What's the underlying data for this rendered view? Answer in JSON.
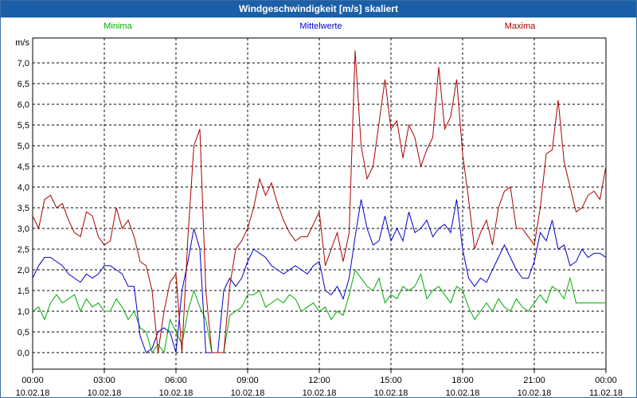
{
  "window": {
    "title": "Windgeschwindigkeit [m/s] skaliert"
  },
  "chart_data": {
    "type": "line",
    "title": "Windgeschwindigkeit [m/s] skaliert",
    "ylabel": "m/s",
    "ylim": [
      -0.4,
      7.6
    ],
    "xlim": [
      0,
      24
    ],
    "grid": true,
    "legend_placement": "top",
    "y_ticks": [
      "0,0",
      "0,5",
      "1,0",
      "1,5",
      "2,0",
      "2,5",
      "3,0",
      "3,5",
      "4,0",
      "4,5",
      "5,0",
      "5,5",
      "6,0",
      "6,5",
      "7,0"
    ],
    "x_ticks": [
      {
        "time": "00:00",
        "date": "10.02.18"
      },
      {
        "time": "03:00",
        "date": "10.02.18"
      },
      {
        "time": "06:00",
        "date": "10.02.18"
      },
      {
        "time": "09:00",
        "date": "10.02.18"
      },
      {
        "time": "12:00",
        "date": "10.02.18"
      },
      {
        "time": "15:00",
        "date": "10.02.18"
      },
      {
        "time": "18:00",
        "date": "10.02.18"
      },
      {
        "time": "21:00",
        "date": "10.02.18"
      },
      {
        "time": "00:00",
        "date": "11.02.18"
      }
    ],
    "series": [
      {
        "name": "Minima",
        "color": "#00aa00",
        "points": [
          [
            0,
            1.0
          ],
          [
            0.25,
            1.1
          ],
          [
            0.5,
            0.8
          ],
          [
            0.75,
            1.2
          ],
          [
            1,
            1.4
          ],
          [
            1.25,
            1.2
          ],
          [
            1.5,
            1.3
          ],
          [
            1.75,
            1.4
          ],
          [
            2,
            1.0
          ],
          [
            2.25,
            1.3
          ],
          [
            2.5,
            1.1
          ],
          [
            2.75,
            1.2
          ],
          [
            3,
            1.0
          ],
          [
            3.25,
            1.0
          ],
          [
            3.5,
            1.3
          ],
          [
            3.75,
            1.1
          ],
          [
            4,
            0.8
          ],
          [
            4.25,
            1.0
          ],
          [
            4.5,
            0.6
          ],
          [
            4.75,
            0.5
          ],
          [
            5,
            0.0
          ],
          [
            5.25,
            0.2
          ],
          [
            5.5,
            0.0
          ],
          [
            5.75,
            0.8
          ],
          [
            6,
            0.5
          ],
          [
            6.25,
            0.2
          ],
          [
            6.5,
            1.0
          ],
          [
            6.75,
            1.5
          ],
          [
            7,
            1.1
          ],
          [
            7.25,
            0.8
          ],
          [
            7.5,
            0.0
          ],
          [
            7.75,
            0.0
          ],
          [
            8,
            0.0
          ],
          [
            8.25,
            0.9
          ],
          [
            8.5,
            1.0
          ],
          [
            8.75,
            1.1
          ],
          [
            9,
            1.4
          ],
          [
            9.25,
            1.4
          ],
          [
            9.5,
            1.5
          ],
          [
            9.75,
            1.1
          ],
          [
            10,
            1.2
          ],
          [
            10.25,
            1.3
          ],
          [
            10.5,
            1.2
          ],
          [
            10.75,
            1.4
          ],
          [
            11,
            1.3
          ],
          [
            11.25,
            1.0
          ],
          [
            11.5,
            1.1
          ],
          [
            11.75,
            1.2
          ],
          [
            12,
            1.0
          ],
          [
            12.25,
            1.1
          ],
          [
            12.5,
            0.8
          ],
          [
            12.75,
            1.0
          ],
          [
            13,
            0.9
          ],
          [
            13.25,
            1.4
          ],
          [
            13.5,
            2.0
          ],
          [
            13.75,
            1.8
          ],
          [
            14,
            1.6
          ],
          [
            14.25,
            1.5
          ],
          [
            14.5,
            1.8
          ],
          [
            14.75,
            1.2
          ],
          [
            15,
            1.4
          ],
          [
            15.25,
            1.3
          ],
          [
            15.5,
            1.6
          ],
          [
            15.75,
            1.5
          ],
          [
            16,
            1.6
          ],
          [
            16.25,
            1.9
          ],
          [
            16.5,
            1.3
          ],
          [
            16.75,
            1.5
          ],
          [
            17,
            1.6
          ],
          [
            17.25,
            1.4
          ],
          [
            17.5,
            1.2
          ],
          [
            17.75,
            1.6
          ],
          [
            18,
            1.5
          ],
          [
            18.25,
            1.1
          ],
          [
            18.5,
            0.8
          ],
          [
            18.75,
            1.0
          ],
          [
            19,
            1.2
          ],
          [
            19.25,
            1.0
          ],
          [
            19.5,
            1.3
          ],
          [
            19.75,
            1.1
          ],
          [
            20,
            1.0
          ],
          [
            20.25,
            1.3
          ],
          [
            20.5,
            1.1
          ],
          [
            20.75,
            1.0
          ],
          [
            21,
            1.2
          ],
          [
            21.25,
            1.4
          ],
          [
            21.5,
            1.2
          ],
          [
            21.75,
            1.6
          ],
          [
            22,
            1.5
          ],
          [
            22.25,
            1.3
          ],
          [
            22.5,
            1.8
          ],
          [
            22.75,
            1.2
          ],
          [
            23,
            1.2
          ],
          [
            23.25,
            1.2
          ],
          [
            23.5,
            1.2
          ],
          [
            23.75,
            1.2
          ],
          [
            24,
            1.2
          ]
        ]
      },
      {
        "name": "Mittelwerte",
        "color": "#0000cc",
        "points": [
          [
            0,
            1.8
          ],
          [
            0.25,
            2.1
          ],
          [
            0.5,
            2.3
          ],
          [
            0.75,
            2.3
          ],
          [
            1,
            2.2
          ],
          [
            1.25,
            2.1
          ],
          [
            1.5,
            1.9
          ],
          [
            1.75,
            1.8
          ],
          [
            2,
            1.7
          ],
          [
            2.25,
            1.9
          ],
          [
            2.5,
            1.8
          ],
          [
            2.75,
            1.9
          ],
          [
            3,
            2.1
          ],
          [
            3.25,
            2.1
          ],
          [
            3.5,
            2.0
          ],
          [
            3.75,
            1.9
          ],
          [
            4,
            1.6
          ],
          [
            4.25,
            1.6
          ],
          [
            4.5,
            0.4
          ],
          [
            4.75,
            0.0
          ],
          [
            5,
            0.1
          ],
          [
            5.25,
            0.5
          ],
          [
            5.5,
            0.6
          ],
          [
            5.75,
            0.5
          ],
          [
            6,
            0.0
          ],
          [
            6.25,
            1.5
          ],
          [
            6.5,
            2.2
          ],
          [
            6.75,
            3.0
          ],
          [
            7,
            2.5
          ],
          [
            7.25,
            0.0
          ],
          [
            7.5,
            0.0
          ],
          [
            7.75,
            0.0
          ],
          [
            8,
            1.5
          ],
          [
            8.25,
            1.8
          ],
          [
            8.5,
            1.6
          ],
          [
            8.75,
            1.8
          ],
          [
            9,
            2.2
          ],
          [
            9.25,
            2.5
          ],
          [
            9.5,
            2.4
          ],
          [
            9.75,
            2.3
          ],
          [
            10,
            2.1
          ],
          [
            10.25,
            2.0
          ],
          [
            10.5,
            1.9
          ],
          [
            10.75,
            2.0
          ],
          [
            11,
            2.1
          ],
          [
            11.25,
            2.0
          ],
          [
            11.5,
            1.9
          ],
          [
            11.75,
            2.1
          ],
          [
            12,
            2.2
          ],
          [
            12.25,
            1.5
          ],
          [
            12.5,
            1.4
          ],
          [
            12.75,
            1.6
          ],
          [
            13,
            1.3
          ],
          [
            13.25,
            1.8
          ],
          [
            13.5,
            2.8
          ],
          [
            13.75,
            3.7
          ],
          [
            14,
            3.0
          ],
          [
            14.25,
            2.6
          ],
          [
            14.5,
            2.7
          ],
          [
            14.75,
            3.3
          ],
          [
            15,
            2.7
          ],
          [
            15.25,
            3.0
          ],
          [
            15.5,
            2.7
          ],
          [
            15.75,
            3.4
          ],
          [
            16,
            2.9
          ],
          [
            16.25,
            3.0
          ],
          [
            16.5,
            3.2
          ],
          [
            16.75,
            2.8
          ],
          [
            17,
            3.0
          ],
          [
            17.25,
            3.1
          ],
          [
            17.5,
            2.9
          ],
          [
            17.75,
            3.7
          ],
          [
            18,
            2.5
          ],
          [
            18.25,
            1.8
          ],
          [
            18.5,
            1.6
          ],
          [
            18.75,
            1.8
          ],
          [
            19,
            1.7
          ],
          [
            19.25,
            2.0
          ],
          [
            19.5,
            2.3
          ],
          [
            19.75,
            2.6
          ],
          [
            20,
            2.3
          ],
          [
            20.25,
            2.0
          ],
          [
            20.5,
            1.8
          ],
          [
            20.75,
            1.8
          ],
          [
            21,
            2.2
          ],
          [
            21.25,
            2.9
          ],
          [
            21.5,
            2.7
          ],
          [
            21.75,
            3.2
          ],
          [
            22,
            2.5
          ],
          [
            22.25,
            2.6
          ],
          [
            22.5,
            2.1
          ],
          [
            22.75,
            2.2
          ],
          [
            23,
            2.5
          ],
          [
            23.25,
            2.3
          ],
          [
            23.5,
            2.4
          ],
          [
            23.75,
            2.4
          ],
          [
            24,
            2.3
          ]
        ]
      },
      {
        "name": "Maxima",
        "color": "#aa0000",
        "points": [
          [
            0,
            3.3
          ],
          [
            0.25,
            3.0
          ],
          [
            0.5,
            3.7
          ],
          [
            0.75,
            3.8
          ],
          [
            1,
            3.5
          ],
          [
            1.25,
            3.6
          ],
          [
            1.5,
            3.2
          ],
          [
            1.75,
            2.9
          ],
          [
            2,
            2.8
          ],
          [
            2.25,
            3.4
          ],
          [
            2.5,
            3.3
          ],
          [
            2.75,
            2.8
          ],
          [
            3,
            2.6
          ],
          [
            3.25,
            2.7
          ],
          [
            3.5,
            3.5
          ],
          [
            3.75,
            3.0
          ],
          [
            4,
            3.2
          ],
          [
            4.25,
            2.8
          ],
          [
            4.5,
            2.2
          ],
          [
            4.75,
            2.1
          ],
          [
            5,
            1.5
          ],
          [
            5.25,
            0.0
          ],
          [
            5.5,
            1.0
          ],
          [
            5.75,
            1.7
          ],
          [
            6,
            1.9
          ],
          [
            6.25,
            0.0
          ],
          [
            6.5,
            2.8
          ],
          [
            6.75,
            5.0
          ],
          [
            7,
            5.4
          ],
          [
            7.25,
            1.5
          ],
          [
            7.5,
            0.0
          ],
          [
            7.75,
            0.0
          ],
          [
            8,
            0.0
          ],
          [
            8.25,
            1.6
          ],
          [
            8.5,
            2.5
          ],
          [
            8.75,
            2.7
          ],
          [
            9,
            3.0
          ],
          [
            9.25,
            3.5
          ],
          [
            9.5,
            4.2
          ],
          [
            9.75,
            3.8
          ],
          [
            10,
            4.1
          ],
          [
            10.25,
            3.6
          ],
          [
            10.5,
            3.2
          ],
          [
            10.75,
            2.9
          ],
          [
            11,
            2.7
          ],
          [
            11.25,
            2.8
          ],
          [
            11.5,
            2.8
          ],
          [
            11.75,
            3.1
          ],
          [
            12,
            3.4
          ],
          [
            12.25,
            2.1
          ],
          [
            12.5,
            2.5
          ],
          [
            12.75,
            2.9
          ],
          [
            13,
            2.2
          ],
          [
            13.25,
            2.9
          ],
          [
            13.5,
            7.3
          ],
          [
            13.75,
            5.0
          ],
          [
            14,
            4.2
          ],
          [
            14.25,
            4.5
          ],
          [
            14.75,
            6.6
          ],
          [
            15,
            5.4
          ],
          [
            15.25,
            5.6
          ],
          [
            15.5,
            4.7
          ],
          [
            15.75,
            5.5
          ],
          [
            16,
            5.2
          ],
          [
            16.25,
            4.5
          ],
          [
            16.5,
            4.9
          ],
          [
            16.75,
            5.2
          ],
          [
            17,
            6.9
          ],
          [
            17.25,
            5.4
          ],
          [
            17.5,
            5.7
          ],
          [
            17.75,
            6.6
          ],
          [
            18,
            4.8
          ],
          [
            18.25,
            3.7
          ],
          [
            18.5,
            2.5
          ],
          [
            18.75,
            2.9
          ],
          [
            19,
            3.2
          ],
          [
            19.25,
            2.6
          ],
          [
            19.5,
            3.5
          ],
          [
            19.75,
            3.9
          ],
          [
            20,
            4.0
          ],
          [
            20.25,
            3.0
          ],
          [
            20.5,
            3.0
          ],
          [
            20.75,
            2.8
          ],
          [
            21,
            2.6
          ],
          [
            21.25,
            3.5
          ],
          [
            21.5,
            4.8
          ],
          [
            21.75,
            4.9
          ],
          [
            22,
            6.1
          ],
          [
            22.25,
            4.6
          ],
          [
            22.5,
            4.0
          ],
          [
            22.75,
            3.4
          ],
          [
            23,
            3.5
          ],
          [
            23.25,
            3.8
          ],
          [
            23.5,
            3.9
          ],
          [
            23.75,
            3.7
          ],
          [
            24,
            4.5
          ]
        ]
      }
    ]
  }
}
